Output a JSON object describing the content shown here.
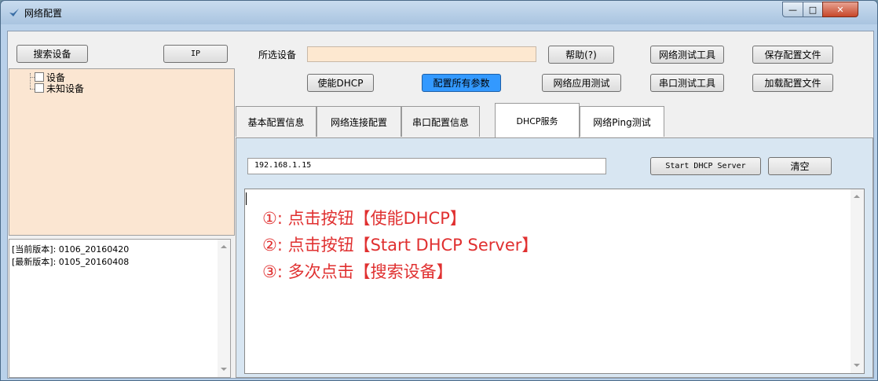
{
  "window": {
    "title": "网络配置",
    "minimize": "—",
    "maximize": "□",
    "close": "✕"
  },
  "left": {
    "search_button": "搜索设备",
    "ip_button": "IP",
    "tree": [
      "设备",
      "未知设备"
    ],
    "versions": [
      "[当前版本]: 0106_20160420",
      "[最新版本]: 0105_20160408"
    ]
  },
  "top": {
    "selected_device_label": "所选设备",
    "selected_device_value": "",
    "buttons": {
      "enable_dhcp": "使能DHCP",
      "config_all": "配置所有参数",
      "help": "帮助(?)",
      "net_app_test": "网络应用测试",
      "net_test_tool": "网络测试工具",
      "serial_test_tool": "串口测试工具",
      "save_config": "保存配置文件",
      "load_config": "加载配置文件"
    }
  },
  "tabs": [
    "基本配置信息",
    "网络连接配置",
    "串口配置信息",
    "DHCP服务",
    "网络Ping测试"
  ],
  "dhcp": {
    "ip": "192.168.1.15",
    "start_button": "Start DHCP Server",
    "clear_button": "清空",
    "instructions": [
      "①: 点击按钮【使能DHCP】",
      "②: 点击按钮【Start DHCP Server】",
      "③: 多次点击【搜索设备】"
    ]
  },
  "colors": {
    "accent_button": "#3399ff",
    "instruction_text": "#e03030",
    "tree_bg": "#fbe6d2"
  }
}
